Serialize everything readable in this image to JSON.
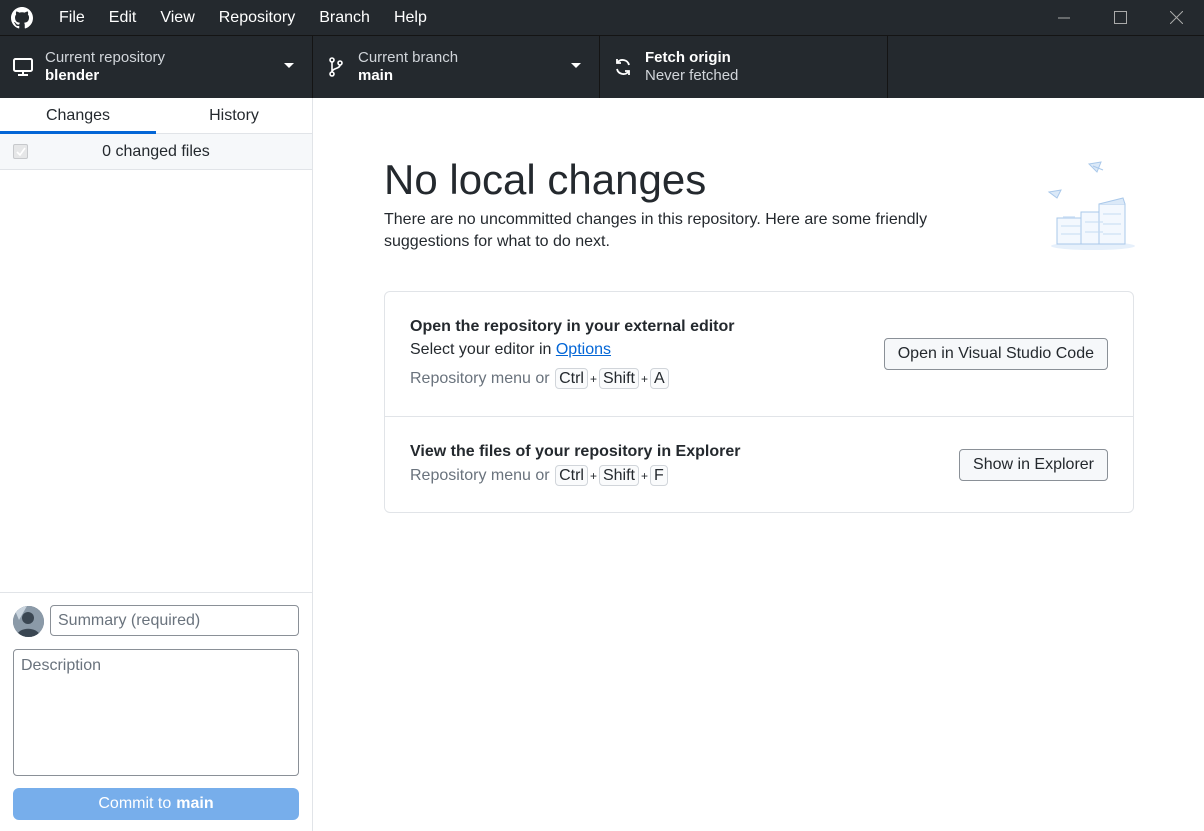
{
  "menu": [
    "File",
    "Edit",
    "View",
    "Repository",
    "Branch",
    "Help"
  ],
  "toolbar": {
    "repo": {
      "label": "Current repository",
      "value": "blender"
    },
    "branch": {
      "label": "Current branch",
      "value": "main"
    },
    "fetch": {
      "label": "Fetch origin",
      "value": "Never fetched"
    }
  },
  "sidebar": {
    "tabs": [
      "Changes",
      "History"
    ],
    "active_tab": "Changes",
    "changed_files": "0 changed files",
    "summary_placeholder": "Summary (required)",
    "description_placeholder": "Description",
    "commit_prefix": "Commit to",
    "commit_branch": "main"
  },
  "main": {
    "heading": "No local changes",
    "subtext": "There are no uncommitted changes in this repository. Here are some friendly suggestions for what to do next.",
    "suggestions": [
      {
        "title": "Open the repository in your external editor",
        "desc_prefix": "Select your editor in ",
        "desc_link": "Options",
        "hint_prefix": "Repository menu or",
        "keys": [
          "Ctrl",
          "Shift",
          "A"
        ],
        "button": "Open in Visual Studio Code"
      },
      {
        "title": "View the files of your repository in Explorer",
        "hint_prefix": "Repository menu or",
        "keys": [
          "Ctrl",
          "Shift",
          "F"
        ],
        "button": "Show in Explorer"
      }
    ]
  },
  "colors": {
    "chrome": "#24292e",
    "accent": "#0366d6",
    "commit_button": "#77aeeb"
  }
}
